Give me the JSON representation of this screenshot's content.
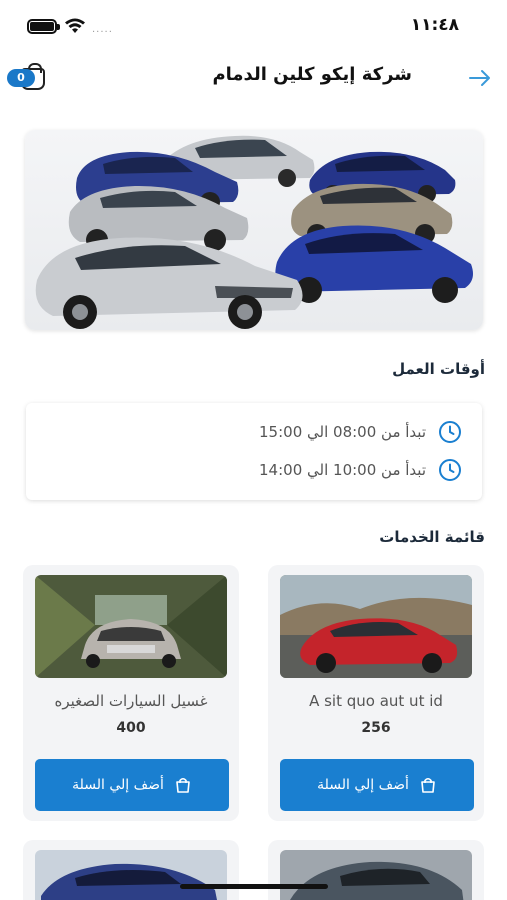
{
  "status_bar": {
    "time": "١١:٤٨",
    "signal": "....."
  },
  "header": {
    "title": "شركة إيكو كلين الدمام",
    "cart_count": "0"
  },
  "sections": {
    "working_hours_title": "أوقات العمل",
    "services_title": "قائمة الخدمات"
  },
  "working_hours": [
    {
      "text": "تبدأ من 08:00 الي 15:00"
    },
    {
      "text": "تبدأ من 10:00 الي 14:00"
    }
  ],
  "services": [
    {
      "name": "A sit quo aut ut id",
      "price": "256",
      "add_label": "أضف إلي السلة"
    },
    {
      "name": "غسيل السيارات الصغيره",
      "price": "400",
      "add_label": "أضف إلي السلة"
    }
  ],
  "colors": {
    "accent": "#1a7fd0",
    "title": "#1c2a3a",
    "card_bg": "#f3f4f6"
  }
}
